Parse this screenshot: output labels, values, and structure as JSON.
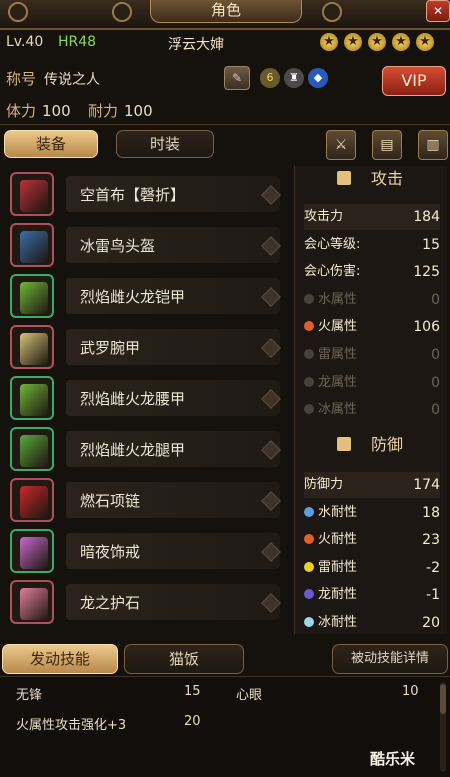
{
  "window": {
    "title": "角色",
    "close_label": "✕"
  },
  "player": {
    "level": "Lv.40",
    "hunter_rank": "HR48",
    "name": "浮云大婶",
    "stars": 5,
    "title_label": "称号",
    "title_value": "传说之人",
    "badge_number": "6",
    "vip_label": "VIP",
    "stamina_label": "体力",
    "stamina_value": "100",
    "endurance_label": "耐力",
    "endurance_value": "100"
  },
  "tabs": [
    {
      "label": "装备",
      "active": true
    },
    {
      "label": "时装",
      "active": false
    }
  ],
  "equipment": [
    {
      "name": "空首布【磬折】",
      "rarity": "pink",
      "color": "#b8333a"
    },
    {
      "name": "冰雷鸟头盔",
      "rarity": "pink",
      "color": "#3a6fa8"
    },
    {
      "name": "烈焰雌火龙铠甲",
      "rarity": "green",
      "color": "#6fb83a"
    },
    {
      "name": "武罗腕甲",
      "rarity": "pink",
      "color": "#d6c27a"
    },
    {
      "name": "烈焰雌火龙腰甲",
      "rarity": "green",
      "color": "#6fb83a"
    },
    {
      "name": "烈焰雌火龙腿甲",
      "rarity": "green",
      "color": "#5aa83a"
    },
    {
      "name": "燃石项链",
      "rarity": "pink",
      "color": "#c82a2a"
    },
    {
      "name": "暗夜饰戒",
      "rarity": "green",
      "color": "#c86acb"
    },
    {
      "name": "龙之护石",
      "rarity": "pink",
      "color": "#e07f9a"
    }
  ],
  "attack": {
    "header": "攻击",
    "stats": [
      {
        "label": "攻击力",
        "value": "184",
        "active": true,
        "icon": ""
      },
      {
        "label": "会心等级:",
        "value": "15",
        "active": true,
        "icon": ""
      },
      {
        "label": "会心伤害:",
        "value": "125",
        "active": true,
        "icon": ""
      },
      {
        "label": "水属性",
        "value": "0",
        "active": false,
        "icon": "water-icon"
      },
      {
        "label": "火属性",
        "value": "106",
        "active": true,
        "icon": "fire-icon"
      },
      {
        "label": "雷属性",
        "value": "0",
        "active": false,
        "icon": "thunder-icon"
      },
      {
        "label": "龙属性",
        "value": "0",
        "active": false,
        "icon": "dragon-icon"
      },
      {
        "label": "冰属性",
        "value": "0",
        "active": false,
        "icon": "ice-icon"
      }
    ]
  },
  "defense": {
    "header": "防御",
    "stats": [
      {
        "label": "防御力",
        "value": "174",
        "active": true,
        "icon": ""
      },
      {
        "label": "水耐性",
        "value": "18",
        "active": true,
        "icon": "water-icon"
      },
      {
        "label": "火耐性",
        "value": "23",
        "active": true,
        "icon": "fire-icon"
      },
      {
        "label": "雷耐性",
        "value": "-2",
        "active": true,
        "icon": "thunder-icon"
      },
      {
        "label": "龙耐性",
        "value": "-1",
        "active": true,
        "icon": "dragon-icon"
      },
      {
        "label": "冰耐性",
        "value": "20",
        "active": true,
        "icon": "ice-icon"
      }
    ]
  },
  "element_colors": {
    "water-icon": "#5aa0e0",
    "fire-icon": "#e0602a",
    "thunder-icon": "#e8d02a",
    "dragon-icon": "#6a5ad0",
    "ice-icon": "#9ad8f0"
  },
  "bottom_tabs": {
    "active_skills": "发动技能",
    "cat_meal": "猫饭",
    "passive_details": "被动技能详情"
  },
  "skills": [
    {
      "name": "无锋",
      "value": "15"
    },
    {
      "name": "心眼",
      "value": "10"
    },
    {
      "name": "火属性攻击强化+3",
      "value": "20"
    }
  ],
  "watermark": "酷乐米"
}
